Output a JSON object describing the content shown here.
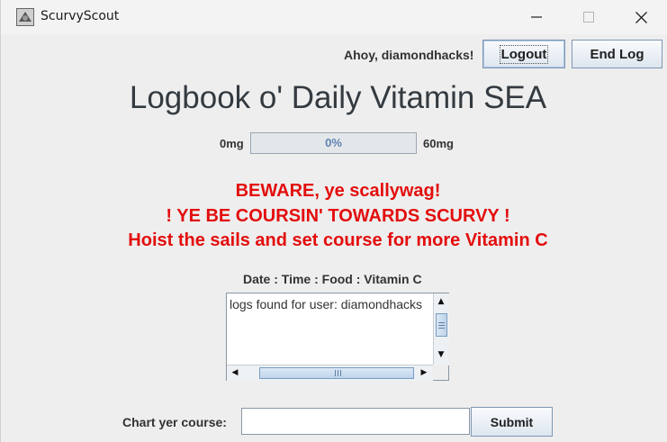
{
  "window": {
    "title": "ScurvyScout",
    "controls": {
      "minimize": "minimize-icon",
      "maximize": "maximize-icon",
      "close": "close-icon"
    }
  },
  "header": {
    "greeting": "Ahoy, diamondhacks!",
    "logout_label": "Logout",
    "end_log_label": "End Log"
  },
  "main": {
    "title": "Logbook o' Daily Vitamin SEA",
    "progress": {
      "min_label": "0mg",
      "max_label": "60mg",
      "value_text": "0%",
      "fraction": 0
    },
    "warnings": [
      "BEWARE, ye scallywag!",
      "! YE BE COURSIN' TOWARDS SCURVY !",
      "Hoist the sails and set course for more Vitamin C"
    ],
    "log_header": "Date : Time : Food : Vitamin C",
    "log_lines": [
      "logs found for user: diamondhacks"
    ]
  },
  "form": {
    "label": "Chart yer course:",
    "input_value": "",
    "submit_label": "Submit"
  },
  "colors": {
    "warning": "#e30d0d",
    "progress_text": "#5f82b0",
    "button_border": "#7f97b3"
  }
}
